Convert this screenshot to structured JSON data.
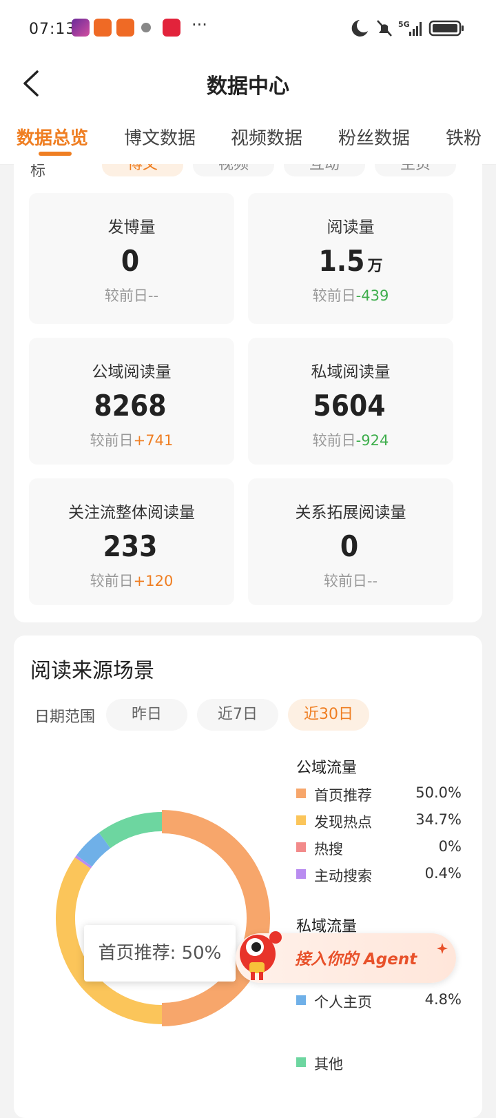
{
  "status_bar": {
    "time": "07:13",
    "network": "5G"
  },
  "header": {
    "title": "数据中心"
  },
  "tabs": [
    {
      "label": "数据总览"
    },
    {
      "label": "博文数据"
    },
    {
      "label": "视频数据"
    },
    {
      "label": "粉丝数据"
    },
    {
      "label": "铁粉"
    }
  ],
  "peek": {
    "label": "标",
    "filters": [
      "博文",
      "视频",
      "互动",
      "主页"
    ]
  },
  "stats": [
    {
      "label": "发博量",
      "value": "0",
      "unit": "",
      "change_label": "较前日",
      "change": "--"
    },
    {
      "label": "阅读量",
      "value": "1.5",
      "unit": "万",
      "change_label": "较前日",
      "change": "-439"
    },
    {
      "label": "公域阅读量",
      "value": "8268",
      "unit": "",
      "change_label": "较前日",
      "change": "+741"
    },
    {
      "label": "私域阅读量",
      "value": "5604",
      "unit": "",
      "change_label": "较前日",
      "change": "-924"
    },
    {
      "label": "关注流整体阅读量",
      "value": "233",
      "unit": "",
      "change_label": "较前日",
      "change": "+120"
    },
    {
      "label": "关系拓展阅读量",
      "value": "0",
      "unit": "",
      "change_label": "较前日",
      "change": "--"
    }
  ],
  "source": {
    "title": "阅读来源场景",
    "range_label": "日期范围",
    "ranges": [
      "昨日",
      "近7日",
      "近30日"
    ],
    "active_range": "近30日",
    "public_title": "公域流量",
    "private_title": "私域流量",
    "tooltip": "首页推荐: 50%",
    "agent_label": "接入你的 Agent"
  },
  "colors": {
    "accent": "#ef7e22",
    "up": "#ef7e22",
    "down": "#3fae4d"
  },
  "chart_data": {
    "type": "pie",
    "title": "",
    "slices": [
      {
        "name": "首页推荐",
        "value": 50.0,
        "color": "#f7a66b",
        "group": "公域流量"
      },
      {
        "name": "发现热点",
        "value": 34.7,
        "color": "#fbc55a",
        "group": "公域流量"
      },
      {
        "name": "热搜",
        "value": 0,
        "color": "#f28a8a",
        "group": "公域流量"
      },
      {
        "name": "主动搜索",
        "value": 0.4,
        "color": "#b98cf0",
        "group": "公域流量"
      },
      {
        "name": "个人主页",
        "value": 4.8,
        "color": "#6fb0e8",
        "group": "私域流量"
      },
      {
        "name": "其他",
        "value": 10.1,
        "color": "#6dd6a0",
        "group": "私域流量"
      }
    ]
  }
}
